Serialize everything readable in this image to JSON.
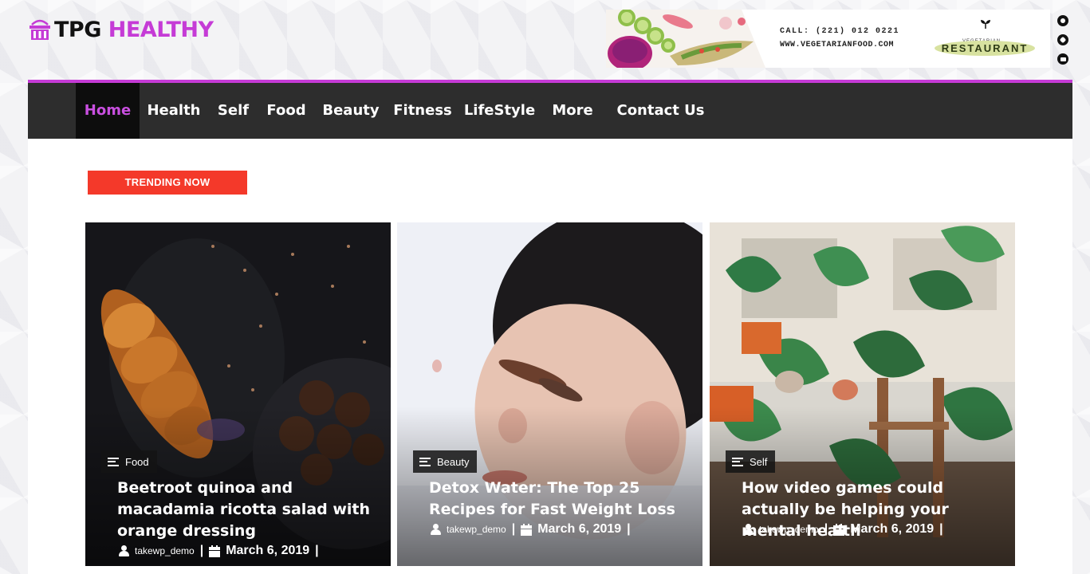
{
  "brand": {
    "name_part1": "TPG ",
    "name_part2": "HEALTHY"
  },
  "banner": {
    "call": "CALL: (221) 012 0221",
    "website": "WWW.VEGETARIANFOOD.COM",
    "tagline": "VEGETARIAN",
    "badge": "RESTAURANT"
  },
  "social": [
    "social-circle-icon",
    "phone-icon",
    "mail-icon"
  ],
  "nav": {
    "items": [
      {
        "label": "Home",
        "active": true
      },
      {
        "label": "Health"
      },
      {
        "label": "Self"
      },
      {
        "label": "Food"
      },
      {
        "label": "Beauty"
      },
      {
        "label": "Fitness"
      },
      {
        "label": "LifeStyle"
      },
      {
        "label": "More +"
      },
      {
        "label": "Contact Us"
      }
    ]
  },
  "trending": {
    "label": "TRENDING NOW"
  },
  "posts": [
    {
      "category": "Food",
      "title": "Beetroot quinoa and macadamia ricotta salad with orange dressing",
      "author": "takewp_demo",
      "date": "March 6, 2019",
      "separator": "|"
    },
    {
      "category": "Beauty",
      "title": "Detox Water: The Top 25 Recipes for Fast Weight Loss",
      "author": "takewp_demo",
      "date": "March 6, 2019",
      "separator": "|"
    },
    {
      "category": "Self",
      "title": "How video games could actually be helping your mental health",
      "author": "takewp_demo",
      "date": "March 6, 2019",
      "separator": "|"
    }
  ],
  "colors": {
    "accent": "#c53bd6",
    "nav_bg": "#2d2d2d",
    "trending_bg": "#f4392a"
  }
}
